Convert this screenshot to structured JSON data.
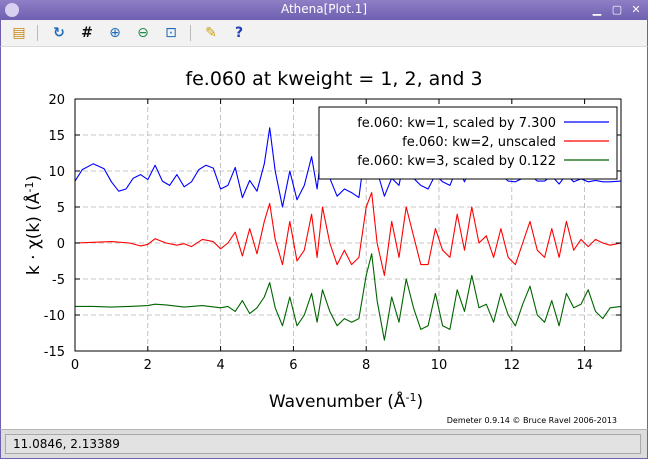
{
  "window": {
    "title": "Athena[Plot.1]",
    "buttons": [
      "minimize",
      "restore",
      "close"
    ]
  },
  "toolbar": {
    "buttons": [
      {
        "name": "open-icon",
        "glyph": "📂"
      },
      {
        "name": "refresh-icon",
        "glyph": "↻"
      },
      {
        "name": "grid-icon",
        "glyph": "#"
      },
      {
        "name": "zoom-in-icon",
        "glyph": "⊕"
      },
      {
        "name": "zoom-out-icon",
        "glyph": "⊖"
      },
      {
        "name": "zoom-reset-icon",
        "glyph": "⊡"
      },
      {
        "name": "settings-icon",
        "glyph": "🔧"
      },
      {
        "name": "help-icon",
        "glyph": "?"
      }
    ]
  },
  "chart_data": {
    "type": "line",
    "title": "fe.060 at kweight = 1, 2, and 3",
    "xlabel": "Wavenumber",
    "xunit": "Å",
    "xunit_exp": "-1",
    "ylabel_prefix": "k",
    "ylabel_func": "χ(k)",
    "ylabel_unit": "Å",
    "ylabel_unit_exp": "-1",
    "xlim": [
      0,
      15
    ],
    "ylim": [
      -15,
      20
    ],
    "xticks": [
      0,
      2,
      4,
      6,
      8,
      10,
      12,
      14
    ],
    "yticks": [
      20,
      15,
      10,
      5,
      0,
      -5,
      -10,
      -15
    ],
    "grid": true,
    "legend_position": "top-right",
    "series": [
      {
        "name": "fe.060: kw=1, scaled by 7.300",
        "color": "#0000ff",
        "x": [
          0,
          0.2,
          0.5,
          0.8,
          1.0,
          1.2,
          1.4,
          1.6,
          1.8,
          2.0,
          2.2,
          2.4,
          2.6,
          2.8,
          3.0,
          3.2,
          3.4,
          3.6,
          3.8,
          4.0,
          4.2,
          4.4,
          4.6,
          4.8,
          5.0,
          5.2,
          5.35,
          5.5,
          5.7,
          5.9,
          6.1,
          6.3,
          6.5,
          6.65,
          6.8,
          7.0,
          7.2,
          7.4,
          7.6,
          7.8,
          8.0,
          8.15,
          8.3,
          8.5,
          8.7,
          8.9,
          9.1,
          9.3,
          9.5,
          9.7,
          9.9,
          10.1,
          10.3,
          10.5,
          10.7,
          10.9,
          11.1,
          11.3,
          11.5,
          11.7,
          11.9,
          12.1,
          12.3,
          12.5,
          12.7,
          12.9,
          13.1,
          13.3,
          13.5,
          13.7,
          13.9,
          14.1,
          14.3,
          14.5,
          14.7,
          15.0
        ],
        "values": [
          8.6,
          10.2,
          11.0,
          10.3,
          8.5,
          7.2,
          7.5,
          9.0,
          9.5,
          8.8,
          10.8,
          8.6,
          8.0,
          9.5,
          7.8,
          8.5,
          10.2,
          10.8,
          10.4,
          7.5,
          8.0,
          10.5,
          6.3,
          8.7,
          7.2,
          11.0,
          16.0,
          10.0,
          5.0,
          10.0,
          6.0,
          8.0,
          12.0,
          7.5,
          14.0,
          9.0,
          6.5,
          7.5,
          7.0,
          6.3,
          14.0,
          17.0,
          10.0,
          6.5,
          9.0,
          8.0,
          13.0,
          9.0,
          8.0,
          7.5,
          9.5,
          8.5,
          8.0,
          10.5,
          8.5,
          11.0,
          9.5,
          10.0,
          9.0,
          9.5,
          8.6,
          8.5,
          9.0,
          9.5,
          8.6,
          8.6,
          9.3,
          8.2,
          9.5,
          8.5,
          8.9,
          8.5,
          8.7,
          8.5,
          8.5,
          8.6
        ]
      },
      {
        "name": "fe.060: kw=2, unscaled",
        "color": "#ff0000",
        "x": [
          0,
          0.5,
          1.0,
          1.5,
          1.8,
          2.0,
          2.2,
          2.5,
          2.8,
          3.0,
          3.2,
          3.5,
          3.8,
          4.0,
          4.2,
          4.4,
          4.6,
          4.8,
          5.0,
          5.2,
          5.35,
          5.5,
          5.7,
          5.9,
          6.1,
          6.3,
          6.5,
          6.65,
          6.8,
          7.0,
          7.2,
          7.4,
          7.6,
          7.8,
          8.0,
          8.15,
          8.3,
          8.5,
          8.7,
          8.9,
          9.1,
          9.3,
          9.5,
          9.7,
          9.9,
          10.1,
          10.3,
          10.5,
          10.7,
          10.9,
          11.1,
          11.3,
          11.5,
          11.7,
          11.9,
          12.1,
          12.3,
          12.5,
          12.7,
          12.9,
          13.1,
          13.3,
          13.5,
          13.7,
          13.9,
          14.1,
          14.3,
          14.5,
          14.7,
          15.0
        ],
        "values": [
          0.0,
          0.1,
          0.2,
          0.0,
          -0.4,
          -0.2,
          0.6,
          0.0,
          -0.3,
          -0.1,
          -0.5,
          0.5,
          0.2,
          -0.8,
          0.0,
          1.5,
          -1.8,
          2.0,
          -1.5,
          3.0,
          5.5,
          0.5,
          -3.0,
          3.0,
          -2.5,
          -1.0,
          4.0,
          -2.0,
          5.0,
          0.0,
          -3.0,
          -1.0,
          -3.0,
          -2.0,
          5.0,
          7.0,
          0.0,
          -4.5,
          3.0,
          -2.0,
          5.0,
          1.0,
          -3.0,
          -3.0,
          2.0,
          -1.0,
          -2.0,
          4.0,
          -1.0,
          5.0,
          0.0,
          1.0,
          -2.0,
          2.0,
          -2.0,
          -3.0,
          0.0,
          3.0,
          -1.0,
          -2.0,
          2.0,
          -2.0,
          3.0,
          -1.0,
          0.5,
          -0.5,
          0.5,
          0.0,
          -0.3,
          0.0
        ]
      },
      {
        "name": "fe.060: kw=3, scaled by 0.122",
        "color": "#006400",
        "x": [
          0,
          0.5,
          1.0,
          1.5,
          2.0,
          2.2,
          2.5,
          3.0,
          3.5,
          4.0,
          4.2,
          4.4,
          4.6,
          4.8,
          5.0,
          5.2,
          5.35,
          5.5,
          5.7,
          5.9,
          6.1,
          6.3,
          6.5,
          6.65,
          6.8,
          7.0,
          7.2,
          7.4,
          7.6,
          7.8,
          8.0,
          8.15,
          8.3,
          8.5,
          8.7,
          8.9,
          9.1,
          9.3,
          9.5,
          9.7,
          9.9,
          10.1,
          10.3,
          10.5,
          10.7,
          10.9,
          11.1,
          11.3,
          11.5,
          11.7,
          11.9,
          12.1,
          12.3,
          12.5,
          12.7,
          12.9,
          13.1,
          13.3,
          13.5,
          13.7,
          13.9,
          14.1,
          14.3,
          14.5,
          14.7,
          15.0
        ],
        "values": [
          -8.8,
          -8.8,
          -8.9,
          -8.8,
          -8.7,
          -8.5,
          -8.6,
          -8.9,
          -8.7,
          -9.0,
          -8.8,
          -9.5,
          -8.0,
          -9.8,
          -9.0,
          -7.5,
          -5.5,
          -9.0,
          -11.5,
          -7.5,
          -11.5,
          -10.0,
          -7.0,
          -11.0,
          -6.5,
          -9.5,
          -11.5,
          -10.5,
          -11.0,
          -10.5,
          -4.5,
          -1.5,
          -8.0,
          -13.5,
          -7.5,
          -11.0,
          -5.0,
          -9.0,
          -12.0,
          -11.5,
          -7.0,
          -11.5,
          -12.0,
          -6.5,
          -9.5,
          -4.5,
          -9.0,
          -8.5,
          -11.0,
          -7.0,
          -10.0,
          -11.5,
          -8.5,
          -6.0,
          -10.0,
          -11.0,
          -8.0,
          -11.5,
          -7.0,
          -9.0,
          -8.5,
          -6.5,
          -9.5,
          -10.5,
          -9.0,
          -8.8
        ]
      }
    ]
  },
  "credit": "Demeter 0.9.14 © Bruce Ravel 2006-2013",
  "status": {
    "coords": "11.0846,  2.13389"
  }
}
